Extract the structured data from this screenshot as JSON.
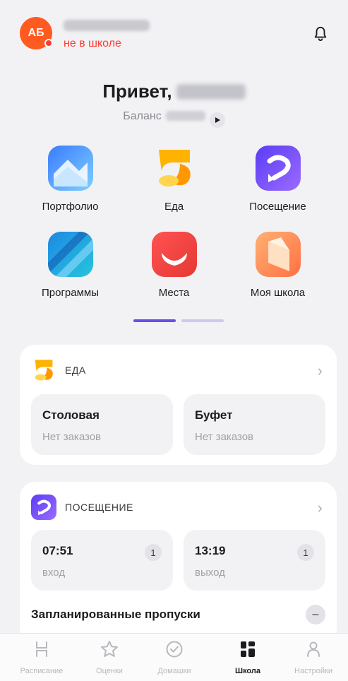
{
  "header": {
    "avatar_initials": "АБ",
    "status": "не в школе"
  },
  "greeting": {
    "text": "Привет,",
    "balance_label": "Баланс"
  },
  "services": [
    {
      "label": "Портфолио",
      "icon": "portfolio-icon"
    },
    {
      "label": "Еда",
      "icon": "food-icon"
    },
    {
      "label": "Посещение",
      "icon": "attendance-icon"
    },
    {
      "label": "Программы",
      "icon": "programs-icon"
    },
    {
      "label": "Места",
      "icon": "places-icon"
    },
    {
      "label": "Моя школа",
      "icon": "my-school-icon"
    }
  ],
  "pager": {
    "pages": 2,
    "active": 1
  },
  "food_card": {
    "title": "ЕДА",
    "items": [
      {
        "title": "Столовая",
        "subtitle": "Нет заказов"
      },
      {
        "title": "Буфет",
        "subtitle": "Нет заказов"
      }
    ]
  },
  "attendance_card": {
    "title": "ПОСЕЩЕНИЕ",
    "items": [
      {
        "time": "07:51",
        "label": "вход",
        "count": "1"
      },
      {
        "time": "13:19",
        "label": "выход",
        "count": "1"
      }
    ],
    "planned_absences": "Запланированные пропуски"
  },
  "tabbar": [
    {
      "label": "Расписание",
      "icon": "schedule-icon"
    },
    {
      "label": "Оценки",
      "icon": "star-icon"
    },
    {
      "label": "Домашки",
      "icon": "check-circle-icon"
    },
    {
      "label": "Школа",
      "icon": "school-grid-icon",
      "active": true
    },
    {
      "label": "Настройки",
      "icon": "profile-icon"
    }
  ],
  "colors": {
    "accent": "#6b4ee8",
    "status_red": "#ff3b30",
    "avatar": "#ff5a1f"
  }
}
